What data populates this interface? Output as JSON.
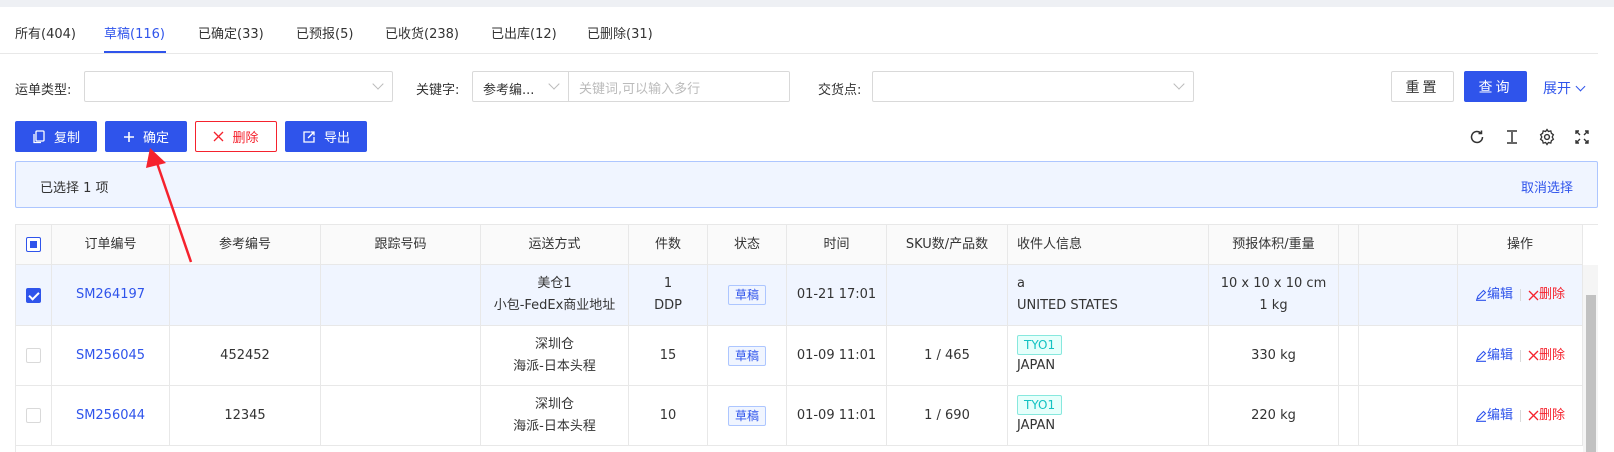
{
  "tabs": [
    {
      "label": "所有(404)"
    },
    {
      "label": "草稿(116)"
    },
    {
      "label": "已确定(33)"
    },
    {
      "label": "已预报(5)"
    },
    {
      "label": "已收货(238)"
    },
    {
      "label": "已出库(12)"
    },
    {
      "label": "已删除(31)"
    }
  ],
  "active_tab": "草稿(116)",
  "filters": {
    "waybill_type_label": "运单类型:",
    "waybill_type_value": "",
    "keyword_label": "关键字:",
    "keyword_type_value": "参考编...",
    "keyword_placeholder": "关键词,可以输入多行",
    "delivery_point_label": "交货点:",
    "delivery_point_value": "",
    "reset_label": "重置",
    "query_label": "查询",
    "expand_label": "展开"
  },
  "actions": {
    "copy_label": "复制",
    "confirm_label": "确定",
    "delete_label": "删除",
    "export_label": "导出"
  },
  "toolbar_icons": [
    "refresh-icon",
    "column-height-icon",
    "settings-icon",
    "fullscreen-icon"
  ],
  "selection": {
    "text": "已选择  1  项",
    "clear_label": "取消选择"
  },
  "table": {
    "headers": {
      "order_no": "订单编号",
      "ref_no": "参考编号",
      "tracking_no": "跟踪号码",
      "shipping": "运送方式",
      "pieces": "件数",
      "status": "状态",
      "time": "时间",
      "sku": "SKU数/产品数",
      "recipient": "收件人信息",
      "volume": "预报体积/重量",
      "ops": "操作"
    },
    "rows": [
      {
        "checked": true,
        "order_no": "SM264197",
        "ref_no": "",
        "tracking_no": "",
        "warehouse": "美仓1",
        "channel": "小包-FedEx商业地址",
        "pieces": "1",
        "terms": "DDP",
        "status": "草稿",
        "time": "01-21 17:01",
        "sku": "",
        "recipient_tag": "",
        "recipient_name": "a",
        "recipient_country": "UNITED STATES",
        "dims": "10 x 10 x 10 cm",
        "weight": "1 kg",
        "edit_label": "编辑",
        "delete_label": "删除"
      },
      {
        "checked": false,
        "order_no": "SM256045",
        "ref_no": "452452",
        "tracking_no": "",
        "warehouse": "深圳仓",
        "channel": "海派-日本头程",
        "pieces": "15",
        "terms": "",
        "status": "草稿",
        "time": "01-09 11:01",
        "sku": "1 / 465",
        "recipient_tag": "TYO1",
        "recipient_name": "",
        "recipient_country": "JAPAN",
        "dims": "",
        "weight": "330 kg",
        "edit_label": "编辑",
        "delete_label": "删除"
      },
      {
        "checked": false,
        "order_no": "SM256044",
        "ref_no": "12345",
        "tracking_no": "",
        "warehouse": "深圳仓",
        "channel": "海派-日本头程",
        "pieces": "10",
        "terms": "",
        "status": "草稿",
        "time": "01-09 11:01",
        "sku": "1 / 690",
        "recipient_tag": "TYO1",
        "recipient_name": "",
        "recipient_country": "JAPAN",
        "dims": "",
        "weight": "220 kg",
        "edit_label": "编辑",
        "delete_label": "删除"
      }
    ]
  },
  "colors": {
    "primary": "#2f54eb",
    "danger": "#f5222d",
    "selected_row": "#f0f5ff",
    "tag_cyan": "#13c2c2",
    "annotation_arrow": "#f5222d"
  }
}
